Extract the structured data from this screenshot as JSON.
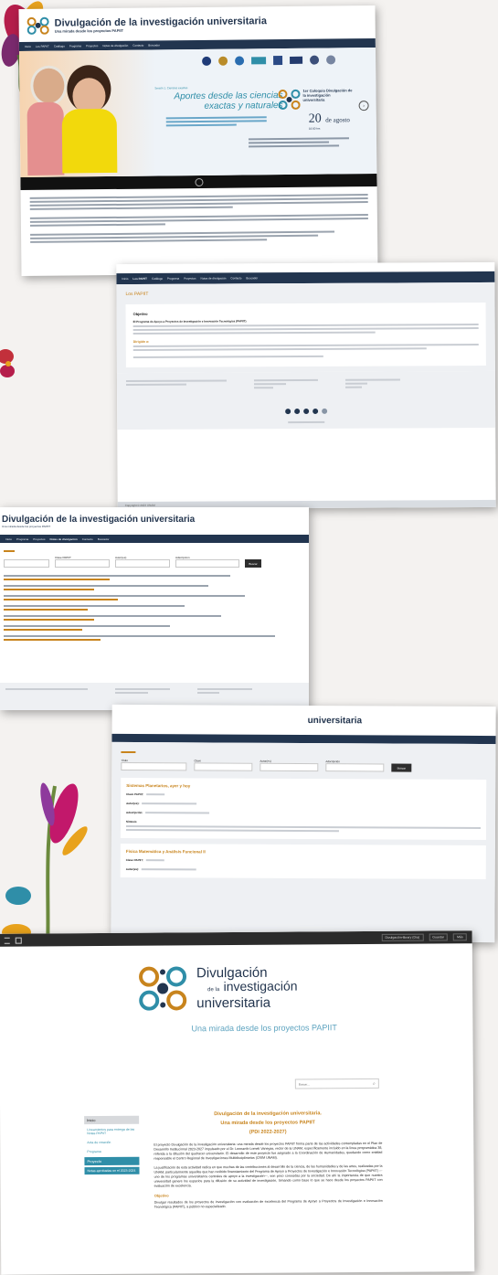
{
  "site": {
    "title": "Divulgación de la investigación universitaria",
    "subtitle": "Una mirada desde los proyectos PAPIIT"
  },
  "nav": {
    "items": [
      "Inicio",
      "Los PAPIIT",
      "Catálogo",
      "Programa",
      "Proyectos",
      "Notas de divulgación",
      "Contacto",
      "Buscador"
    ]
  },
  "hero": {
    "kicker": "Sesión 1. Ciencias exactas",
    "heading": "Aportes desde las ciencias exactas y naturales",
    "event_logo_title": "1er Coloquio Divulgación de la investigación universitaria",
    "date_big": "20",
    "date_month": "de agosto",
    "date_time": "16:00 hrs"
  },
  "shot2": {
    "section_title": "Los PAPIIT",
    "objective_heading": "Objetivo",
    "objective_lead": "El Programa de Apoyo a Proyectos de Investigación e Innovación Tecnológica (PAPIIT)",
    "dirigido_heading": "Dirigido a:",
    "footer_note": "Copyright © 2024 UNAM"
  },
  "shot3": {
    "title": "Divulgación de la investigación universitaria",
    "subtitle": "Una mirada desde los proyectos PAPIIT",
    "filter_labels": [
      "Clave PAPIIT",
      "Autor(es)",
      "Adscripción"
    ],
    "search_button": "Buscar"
  },
  "shot4": {
    "title": "universitaria",
    "filter_labels": [
      "Título",
      "Clave",
      "Autor(es)",
      "Adscripción"
    ],
    "search_button": "Buscar",
    "result1_title": "Sistemas Planetarios, ayer y hoy",
    "result2_title": "Física Matemática y Análisis Funcional II",
    "field_labels": [
      "Clave PAPIIT:",
      "Autor(es):",
      "Adscripción:",
      "Síntesis"
    ]
  },
  "shot5": {
    "toolbar_left": "",
    "toolbar_buttons": [
      "Divulgación-library (Dra)",
      "Guardar",
      "Más"
    ],
    "logo_line1": "Divulgación",
    "logo_line2_small": "de la",
    "logo_line2": "investigación",
    "logo_line3": "universitaria",
    "tagline": "Una mirada desde los proyectos PAPIIT",
    "search_placeholder": "Buscar...",
    "sidebar_items": [
      "Inicio",
      "Lineamientos para entrega de las Notas PAPIIT",
      "Acta de creación",
      "Programa",
      "Proyecto",
      "Notas aprobadas en el 2023-2024"
    ],
    "heading_line1": "Divulgación de la investigación universitaria.",
    "heading_line2": "Una mirada desde los proyectos PAPIIT",
    "heading_line3": "(PDI 2022-2027)",
    "para1": "El proyecto Divulgación de la investigación universitaria: una mirada desde los proyectos PAPIIT forma parte de las actividades contempladas en el Plan de Desarrollo Institucional 2023-2027 impulsado por el Dr. Leonardo Lomelí Vanegas, rector de la UNAM, específicamente incluido en la línea programática 38, referida a la difusión del quehacer universitario. El desarrollo de este proyecto fue asignado a la Coordinación de Humanidades, quedando como entidad responsable el Centro Regional de Investigaciones Multidisciplinarias (CRIM UNAM).",
    "para2": "La justificación de esta actividad radica en que muchas de las contribuciones al desarrollo de la ciencia, de las humanidades y de las artes, realizadas por la UNAM, particularmente aquellas que han recibido financiamiento del Programa de Apoyo a Proyectos de Investigación e Innovación Tecnológica (PAPIIT) —uno de los programas universitarios centrales de apoyo a la investigación—, son poco conocidas por la sociedad. De ahí la importancia de que nuestra universidad genere los espacios para la difusión de su actividad de investigación, tomando como base lo que se hace desde los proyectos PAPIIT con evaluación de excelencia.",
    "objetivo_heading": "Objetivo",
    "para3": "Divulgar resultados de los proyectos de investigación con evaluación de excelencia del Programa de Apoyo a Proyectos de Investigación e Innovación Tecnológica (PAPIIT), a público no especializado."
  },
  "colors": {
    "navy": "#22354f",
    "orange": "#c8841d",
    "teal": "#2f8ea8",
    "rose": "#c2186b"
  }
}
